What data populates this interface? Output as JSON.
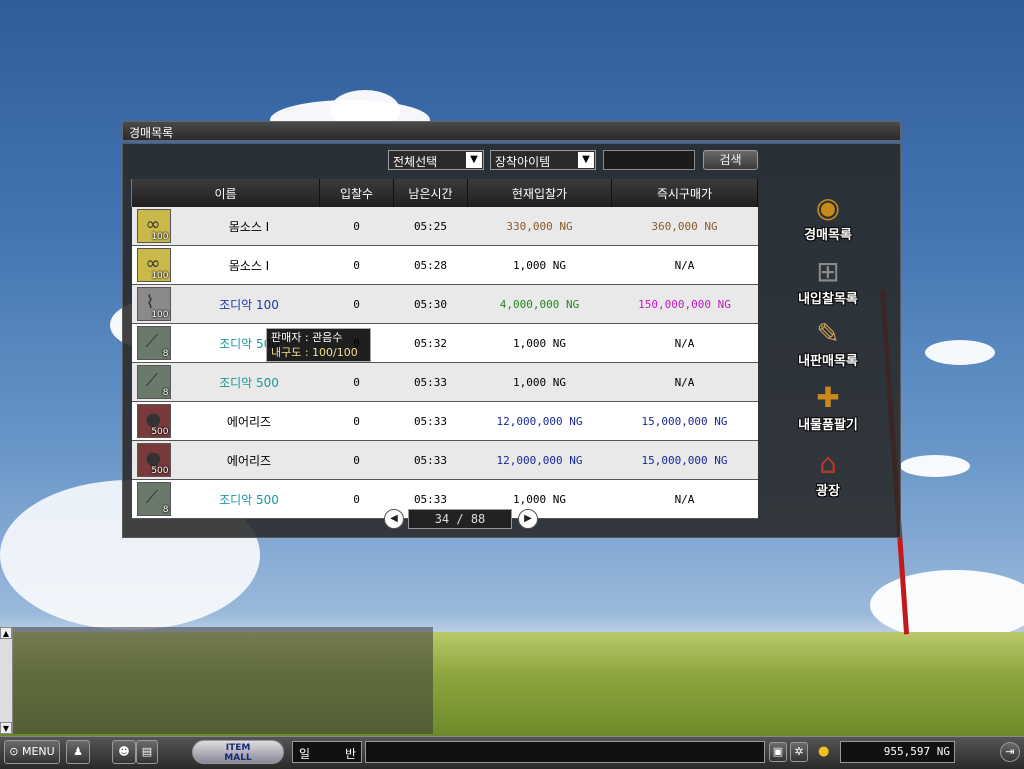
{
  "window": {
    "title": "경매목록"
  },
  "filters": {
    "category": "전체선택",
    "type": "장착아이템",
    "search_value": "",
    "search_button": "검색"
  },
  "table": {
    "headers": [
      "이름",
      "입찰수",
      "남은시간",
      "현재입찰가",
      "즉시구매가"
    ],
    "rows": [
      {
        "icon": "rope-icon",
        "count": "100",
        "name": "몸소스 I",
        "name_color": "#000000",
        "bids": "0",
        "time": "05:25",
        "current": "330,000 NG",
        "current_color": "#8a5a2a",
        "buyout": "360,000 NG",
        "buyout_color": "#8a5a2a"
      },
      {
        "icon": "rope-icon",
        "count": "100",
        "name": "몸소스 I",
        "name_color": "#000000",
        "bids": "0",
        "time": "05:28",
        "current": "1,000 NG",
        "current_color": "#000000",
        "buyout": "N/A",
        "buyout_color": "#000000"
      },
      {
        "icon": "chain-icon",
        "count": "100",
        "name": "조디악 100",
        "name_color": "#1a3aa8",
        "bids": "0",
        "time": "05:30",
        "current": "4,000,000 NG",
        "current_color": "#1f8a1f",
        "buyout": "150,000,000 NG",
        "buyout_color": "#c21ac2"
      },
      {
        "icon": "syringe-icon",
        "count": "8",
        "name": "조디악 500",
        "name_color": "#1a9a9a",
        "bids": "0",
        "time": "05:32",
        "current": "1,000 NG",
        "current_color": "#000000",
        "buyout": "N/A",
        "buyout_color": "#000000"
      },
      {
        "icon": "syringe-icon",
        "count": "8",
        "name": "조디악 500",
        "name_color": "#1a9a9a",
        "bids": "0",
        "time": "05:33",
        "current": "1,000 NG",
        "current_color": "#000000",
        "buyout": "N/A",
        "buyout_color": "#000000"
      },
      {
        "icon": "potion-icon",
        "count": "500",
        "name": "에어리즈",
        "name_color": "#000000",
        "bids": "0",
        "time": "05:33",
        "current": "12,000,000 NG",
        "current_color": "#1a2a9a",
        "buyout": "15,000,000 NG",
        "buyout_color": "#1a2a9a"
      },
      {
        "icon": "potion-icon",
        "count": "500",
        "name": "에어리즈",
        "name_color": "#000000",
        "bids": "0",
        "time": "05:33",
        "current": "12,000,000 NG",
        "current_color": "#1a2a9a",
        "buyout": "15,000,000 NG",
        "buyout_color": "#1a2a9a"
      },
      {
        "icon": "syringe-icon",
        "count": "8",
        "name": "조디악 500",
        "name_color": "#1a9a9a",
        "bids": "0",
        "time": "05:33",
        "current": "1,000 NG",
        "current_color": "#000000",
        "buyout": "N/A",
        "buyout_color": "#000000"
      }
    ]
  },
  "tooltip": {
    "line1": "판매자 : 관음수",
    "line2": "내구도 : 100/100"
  },
  "pager": {
    "text": "34 / 88"
  },
  "side_menu": [
    {
      "label": "경매목록",
      "icon": "auction-list-icon"
    },
    {
      "label": "내입찰목록",
      "icon": "cart-icon"
    },
    {
      "label": "내판매목록",
      "icon": "clipboard-icon"
    },
    {
      "label": "내물품팔기",
      "icon": "sell-item-icon"
    },
    {
      "label": "광장",
      "icon": "plaza-icon"
    }
  ],
  "bottom_bar": {
    "menu_label": "MENU",
    "item_mall_label_1": "ITEM",
    "item_mall_label_2": "MALL",
    "chat_mode_1": "일",
    "chat_mode_2": "반",
    "money": "955,597 NG"
  }
}
